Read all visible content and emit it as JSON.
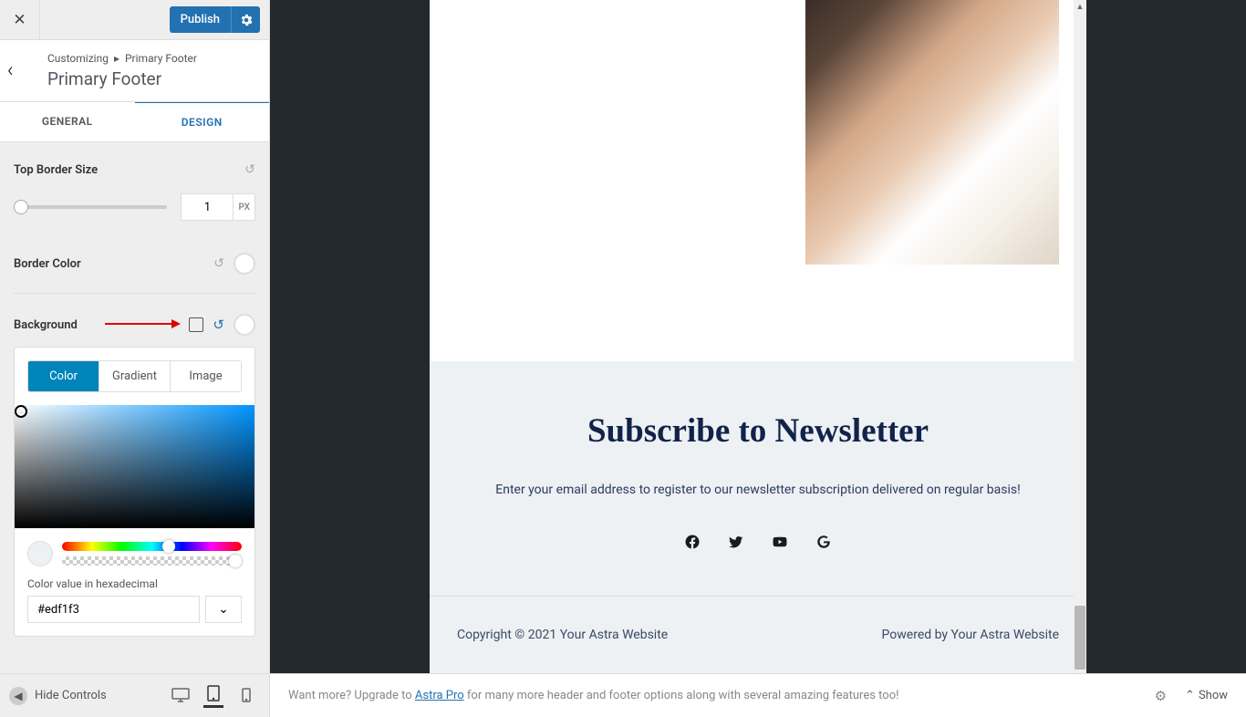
{
  "header": {
    "publish_label": "Publish"
  },
  "breadcrumb": {
    "section": "Customizing",
    "sep": "▸",
    "area": "Primary Footer",
    "title": "Primary Footer"
  },
  "tabs": {
    "general": "GENERAL",
    "design": "DESIGN"
  },
  "controls": {
    "top_border_size": {
      "label": "Top Border Size",
      "value": "1",
      "unit": "PX"
    },
    "border_color": {
      "label": "Border Color"
    },
    "background": {
      "label": "Background"
    }
  },
  "color_picker": {
    "tab_color": "Color",
    "tab_gradient": "Gradient",
    "tab_image": "Image",
    "hex_label": "Color value in hexadecimal",
    "hex_value": "#edf1f3"
  },
  "sidebar_footer": {
    "hide": "Hide Controls"
  },
  "preview": {
    "newsletter_title": "Subscribe to Newsletter",
    "newsletter_sub": "Enter your email address to register to our newsletter subscription delivered on regular basis!",
    "copyright": "Copyright © 2021 Your Astra Website",
    "powered": "Powered by Your Astra Website"
  },
  "bottom": {
    "prefix": "Want more? Upgrade to ",
    "link": "Astra Pro",
    "suffix": " for many more header and footer options along with several amazing features too!",
    "show": "Show"
  }
}
